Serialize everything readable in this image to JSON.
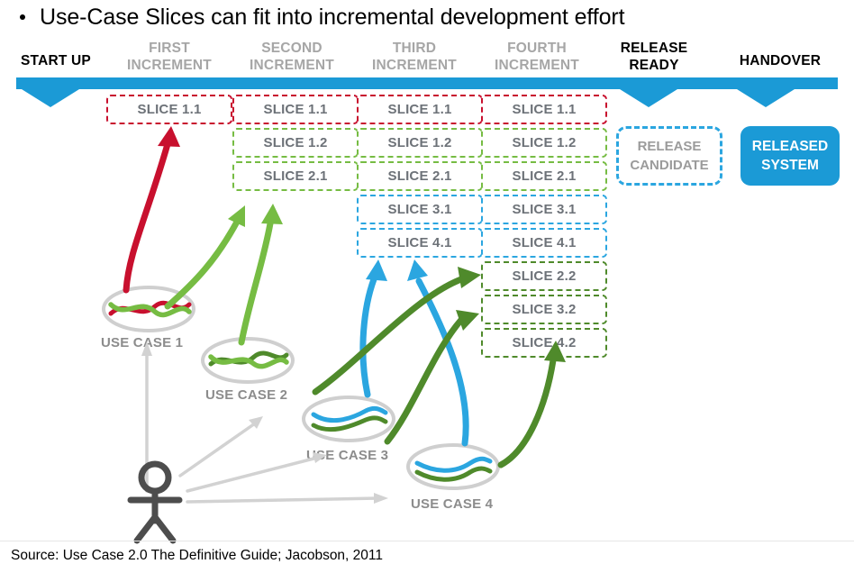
{
  "slide": {
    "title": "Use-Case Slices can fit into incremental development effort",
    "bullet_glyph": "•",
    "source_note": "Source: Use Case 2.0 The Definitive Guide; Jacobson, 2011"
  },
  "colors": {
    "timeline_blue": "#1b9ad6",
    "slice_red": "#c8102e",
    "slice_green": "#76bc43",
    "slice_blue": "#2ba6e0",
    "slice_dark_green": "#4f8a2b",
    "label_gray": "#a6a6a6",
    "text_gray": "#6d7278",
    "actor_gray": "#4d4d4d",
    "arrow_light_gray": "#d2d2d2"
  },
  "timeline": {
    "phases": [
      {
        "line1": "START UP",
        "line2": "",
        "tone": "dark"
      },
      {
        "line1": "FIRST",
        "line2": "INCREMENT",
        "tone": "muted"
      },
      {
        "line1": "SECOND",
        "line2": "INCREMENT",
        "tone": "muted"
      },
      {
        "line1": "THIRD",
        "line2": "INCREMENT",
        "tone": "muted"
      },
      {
        "line1": "FOURTH",
        "line2": "INCREMENT",
        "tone": "muted"
      },
      {
        "line1": "RELEASE",
        "line2": "READY",
        "tone": "dark"
      },
      {
        "line1": "HANDOVER",
        "line2": "",
        "tone": "dark"
      }
    ]
  },
  "columns": [
    {
      "name": "first-increment",
      "slices": [
        {
          "label": "SLICE 1.1",
          "color": "red"
        }
      ]
    },
    {
      "name": "second-increment",
      "slices": [
        {
          "label": "SLICE 1.1",
          "color": "red"
        },
        {
          "label": "SLICE 1.2",
          "color": "green"
        },
        {
          "label": "SLICE 2.1",
          "color": "green"
        }
      ]
    },
    {
      "name": "third-increment",
      "slices": [
        {
          "label": "SLICE 1.1",
          "color": "red"
        },
        {
          "label": "SLICE 1.2",
          "color": "green"
        },
        {
          "label": "SLICE 2.1",
          "color": "green"
        },
        {
          "label": "SLICE 3.1",
          "color": "blue"
        },
        {
          "label": "SLICE 4.1",
          "color": "blue"
        }
      ]
    },
    {
      "name": "fourth-increment",
      "slices": [
        {
          "label": "SLICE 1.1",
          "color": "red"
        },
        {
          "label": "SLICE 1.2",
          "color": "green"
        },
        {
          "label": "SLICE 2.1",
          "color": "green"
        },
        {
          "label": "SLICE 3.1",
          "color": "blue"
        },
        {
          "label": "SLICE 4.1",
          "color": "blue"
        },
        {
          "label": "SLICE 2.2",
          "color": "dgreen"
        },
        {
          "label": "SLICE 3.2",
          "color": "dgreen"
        },
        {
          "label": "SLICE 4.2",
          "color": "dgreen"
        }
      ]
    }
  ],
  "release_candidate": {
    "line1": "RELEASE",
    "line2": "CANDIDATE"
  },
  "released_system": {
    "line1": "RELEASED",
    "line2": "SYSTEM"
  },
  "use_cases": [
    {
      "label": "USE CASE 1",
      "strands": [
        "#c8102e",
        "#76bc43"
      ]
    },
    {
      "label": "USE CASE 2",
      "strands": [
        "#4f8a2b",
        "#76bc43"
      ]
    },
    {
      "label": "USE CASE 3",
      "strands": [
        "#2ba6e0",
        "#4f8a2b"
      ]
    },
    {
      "label": "USE CASE 4",
      "strands": [
        "#2ba6e0",
        "#4f8a2b"
      ]
    }
  ]
}
